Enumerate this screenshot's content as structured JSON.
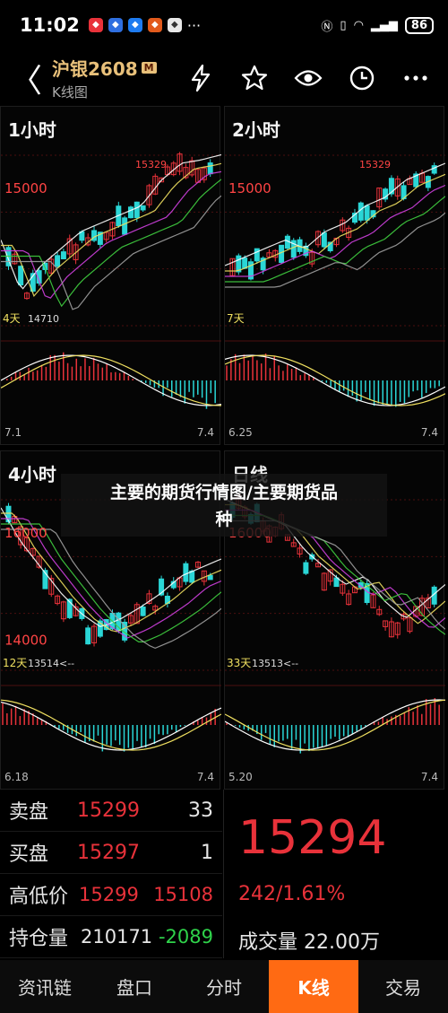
{
  "status": {
    "time": "11:02",
    "battery": "86",
    "more": "···"
  },
  "header": {
    "back": "〈",
    "stock_name": "沪银2608",
    "badge": "M",
    "subtitle": "K线图"
  },
  "panels": [
    {
      "title": "1小时",
      "x_start": "7.1",
      "x_end": "7.4",
      "price_label": "15000",
      "lowest_label": "14710",
      "high_label": "15329",
      "days_label": "4天"
    },
    {
      "title": "2小时",
      "x_start": "6.25",
      "x_end": "7.4",
      "price_label": "15000",
      "high_label": "15329",
      "days_label": "7天"
    },
    {
      "title": "4小时",
      "x_start": "6.18",
      "x_end": "7.4",
      "price_label": "16000",
      "low_price_label": "14000",
      "lowest_label": "13514<--",
      "days_label": "12天"
    },
    {
      "title": "日线",
      "x_start": "5.20",
      "x_end": "7.4",
      "price_label": "16000",
      "lowest_label": "13513<--",
      "days_label": "33天"
    }
  ],
  "banner": {
    "line1": "主要的期货行情图/主要期货品",
    "line2": "种"
  },
  "quote": {
    "sell_label": "卖盘",
    "sell_price": "15299",
    "sell_qty": "33",
    "buy_label": "买盘",
    "buy_price": "15297",
    "buy_qty": "1",
    "hl_label": "高低价",
    "high": "15299",
    "low": "15108",
    "oi_label": "持仓量",
    "oi": "210171",
    "oi_change": "-2089",
    "last_price": "15294",
    "change": "242/1.61%",
    "volume_label": "成交量",
    "volume": "22.00万"
  },
  "tabs": [
    {
      "label": "资讯链",
      "active": false
    },
    {
      "label": "盘口",
      "active": false
    },
    {
      "label": "分时",
      "active": false
    },
    {
      "label": "K线",
      "active": true
    },
    {
      "label": "交易",
      "active": false
    }
  ],
  "colors": {
    "up": "#e8323a",
    "down": "#2ad6d6",
    "accent": "#ff6a13",
    "gold": "#e8c07a"
  }
}
